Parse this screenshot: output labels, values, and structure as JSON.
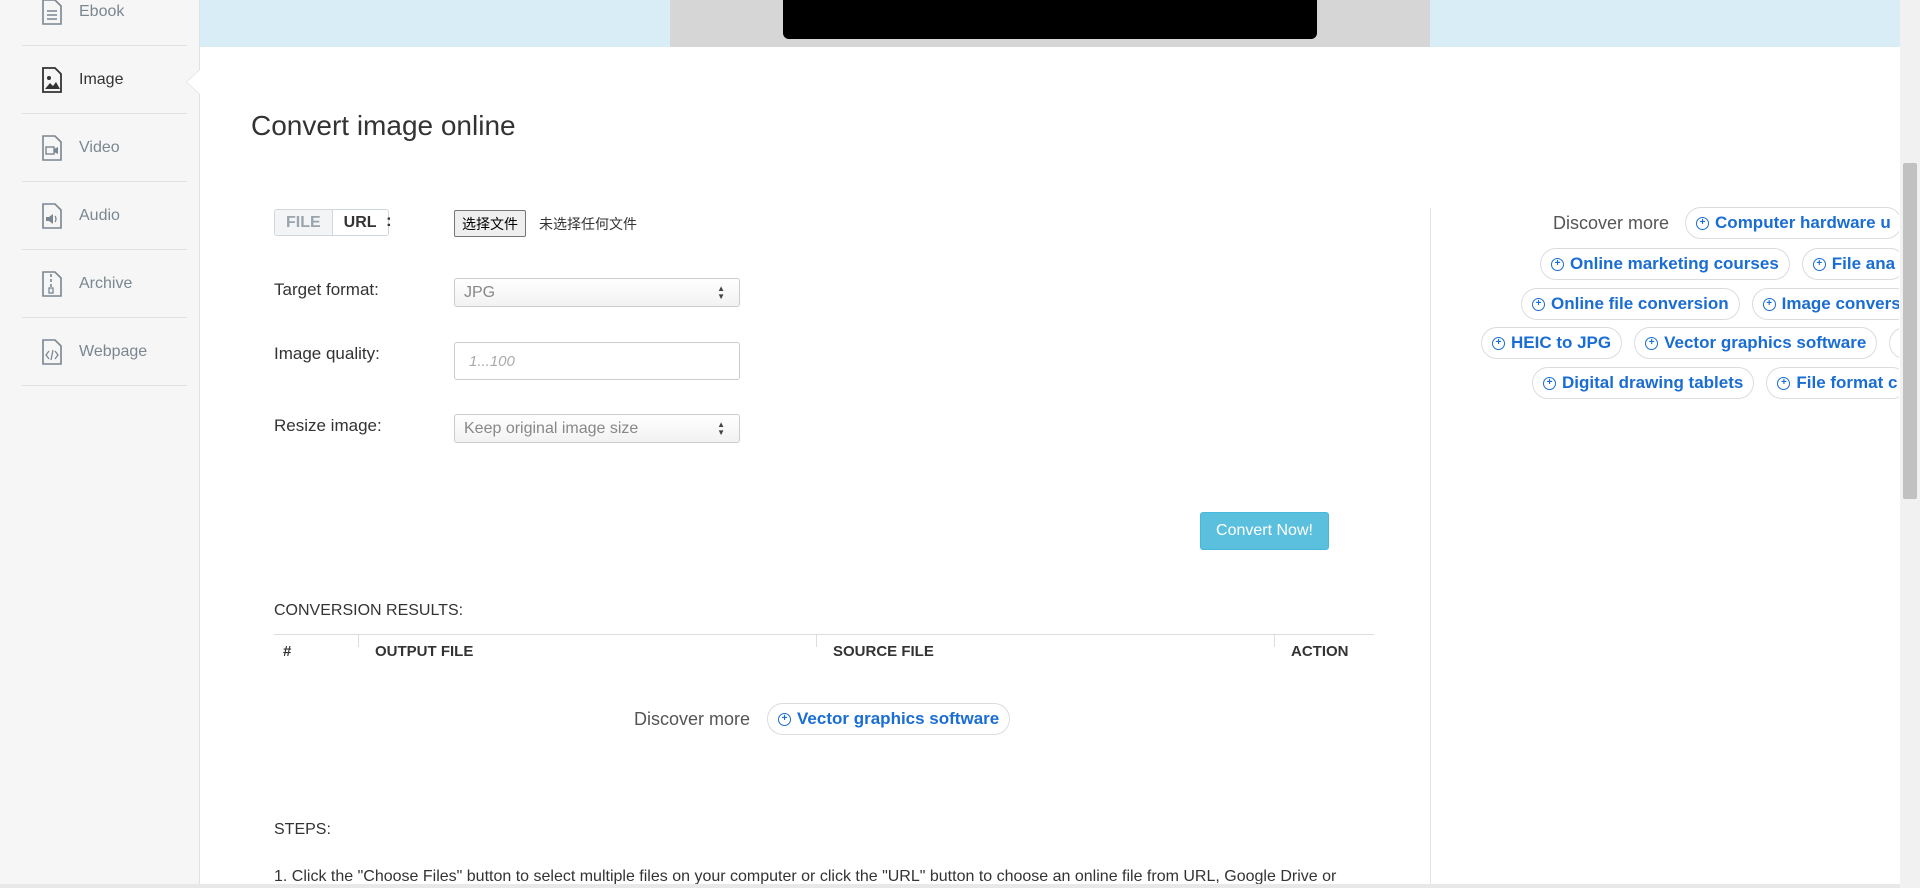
{
  "sidebar": {
    "items": [
      {
        "label": "Ebook",
        "icon": "ebook-icon"
      },
      {
        "label": "Image",
        "icon": "image-icon",
        "active": true
      },
      {
        "label": "Video",
        "icon": "video-icon"
      },
      {
        "label": "Audio",
        "icon": "audio-icon"
      },
      {
        "label": "Archive",
        "icon": "archive-icon"
      },
      {
        "label": "Webpage",
        "icon": "webpage-icon"
      }
    ]
  },
  "main": {
    "title": "Convert image online",
    "source_toggle": {
      "file": "FILE",
      "url": "URL",
      "colon": ":"
    },
    "file_input": {
      "button": "选择文件",
      "status": "未选择任何文件"
    },
    "target_format": {
      "label": "Target format:",
      "value": "JPG"
    },
    "image_quality": {
      "label": "Image quality:",
      "placeholder": "1...100"
    },
    "resize_image": {
      "label": "Resize image:",
      "value": "Keep original image size"
    },
    "convert_button": "Convert Now!",
    "results": {
      "title": "CONVERSION RESULTS:",
      "columns": [
        "#",
        "OUTPUT FILE",
        "SOURCE FILE",
        "ACTION"
      ]
    },
    "discover_inline": {
      "label": "Discover more",
      "chip": "Vector graphics software"
    },
    "steps": {
      "title": "STEPS:",
      "text": "1. Click the \"Choose Files\" button to select multiple files on your computer or click the \"URL\" button to choose an online file from URL, Google Drive or"
    }
  },
  "right_panel": {
    "label": "Discover more",
    "chips": [
      "Computer hardware u",
      "Online marketing courses",
      "File ana",
      "Online file conversion",
      "Image convers",
      "HEIC to JPG",
      "Vector graphics software",
      "Digital drawing tablets",
      "File format c"
    ]
  },
  "colors": {
    "accent": "#5bc0de",
    "link": "#1a6dd3",
    "banner": "#d9edf7",
    "sidebar": "#f6f6f6"
  }
}
